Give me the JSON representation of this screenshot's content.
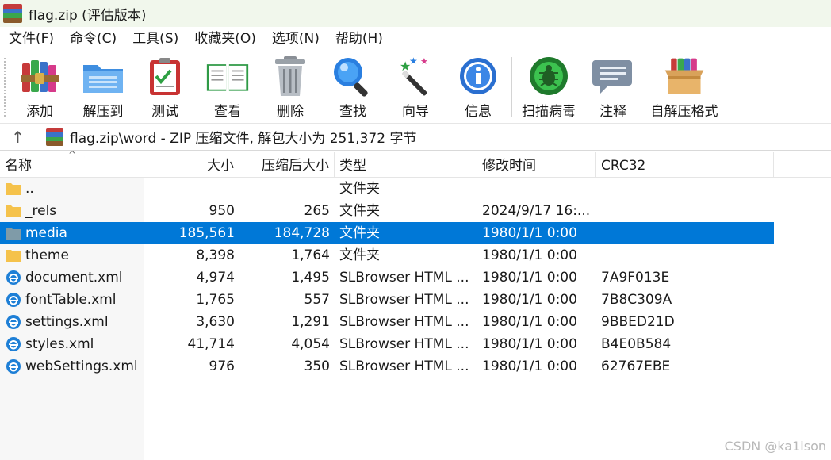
{
  "window": {
    "title": "flag.zip (评估版本)",
    "icon": "winrar-books-icon"
  },
  "menu": [
    "文件(F)",
    "命令(C)",
    "工具(S)",
    "收藏夹(O)",
    "选项(N)",
    "帮助(H)"
  ],
  "toolbar": [
    {
      "label": "添加",
      "icon": "add-archive-icon"
    },
    {
      "label": "解压到",
      "icon": "extract-to-icon"
    },
    {
      "label": "测试",
      "icon": "test-icon"
    },
    {
      "label": "查看",
      "icon": "view-icon"
    },
    {
      "label": "删除",
      "icon": "delete-icon"
    },
    {
      "label": "查找",
      "icon": "find-icon"
    },
    {
      "label": "向导",
      "icon": "wizard-icon"
    },
    {
      "label": "信息",
      "icon": "info-icon"
    },
    {
      "label": "扫描病毒",
      "icon": "virus-scan-icon"
    },
    {
      "label": "注释",
      "icon": "comment-icon"
    },
    {
      "label": "自解压格式",
      "icon": "sfx-icon"
    }
  ],
  "address": {
    "up_glyph": "↑",
    "path": "flag.zip\\word - ZIP 压缩文件, 解包大小为 251,372 字节"
  },
  "columns": {
    "name": "名称",
    "size": "大小",
    "packed": "压缩后大小",
    "type": "类型",
    "modified": "修改时间",
    "crc": "CRC32"
  },
  "sort_glyph": "^",
  "files": [
    {
      "name": "..",
      "size": "",
      "packed": "",
      "type": "文件夹",
      "modified": "",
      "crc": "",
      "kind": "folder",
      "selected": false
    },
    {
      "name": "_rels",
      "size": "950",
      "packed": "265",
      "type": "文件夹",
      "modified": "2024/9/17 16:...",
      "crc": "",
      "kind": "folder",
      "selected": false
    },
    {
      "name": "media",
      "size": "185,561",
      "packed": "184,728",
      "type": "文件夹",
      "modified": "1980/1/1 0:00",
      "crc": "",
      "kind": "folder",
      "selected": true
    },
    {
      "name": "theme",
      "size": "8,398",
      "packed": "1,764",
      "type": "文件夹",
      "modified": "1980/1/1 0:00",
      "crc": "",
      "kind": "folder",
      "selected": false
    },
    {
      "name": "document.xml",
      "size": "4,974",
      "packed": "1,495",
      "type": "SLBrowser HTML ...",
      "modified": "1980/1/1 0:00",
      "crc": "7A9F013E",
      "kind": "xml",
      "selected": false
    },
    {
      "name": "fontTable.xml",
      "size": "1,765",
      "packed": "557",
      "type": "SLBrowser HTML ...",
      "modified": "1980/1/1 0:00",
      "crc": "7B8C309A",
      "kind": "xml",
      "selected": false
    },
    {
      "name": "settings.xml",
      "size": "3,630",
      "packed": "1,291",
      "type": "SLBrowser HTML ...",
      "modified": "1980/1/1 0:00",
      "crc": "9BBED21D",
      "kind": "xml",
      "selected": false
    },
    {
      "name": "styles.xml",
      "size": "41,714",
      "packed": "4,054",
      "type": "SLBrowser HTML ...",
      "modified": "1980/1/1 0:00",
      "crc": "B4E0B584",
      "kind": "xml",
      "selected": false
    },
    {
      "name": "webSettings.xml",
      "size": "976",
      "packed": "350",
      "type": "SLBrowser HTML ...",
      "modified": "1980/1/1 0:00",
      "crc": "62767EBE",
      "kind": "xml",
      "selected": false
    }
  ],
  "watermark": "CSDN @ka1ison",
  "colors": {
    "selection": "#0078d7",
    "titlebar_bg": "#f1f7ec",
    "folder": "#f5c24b",
    "selected_folder": "#7f9ba8",
    "xml_icon": "#1e7fd6"
  }
}
